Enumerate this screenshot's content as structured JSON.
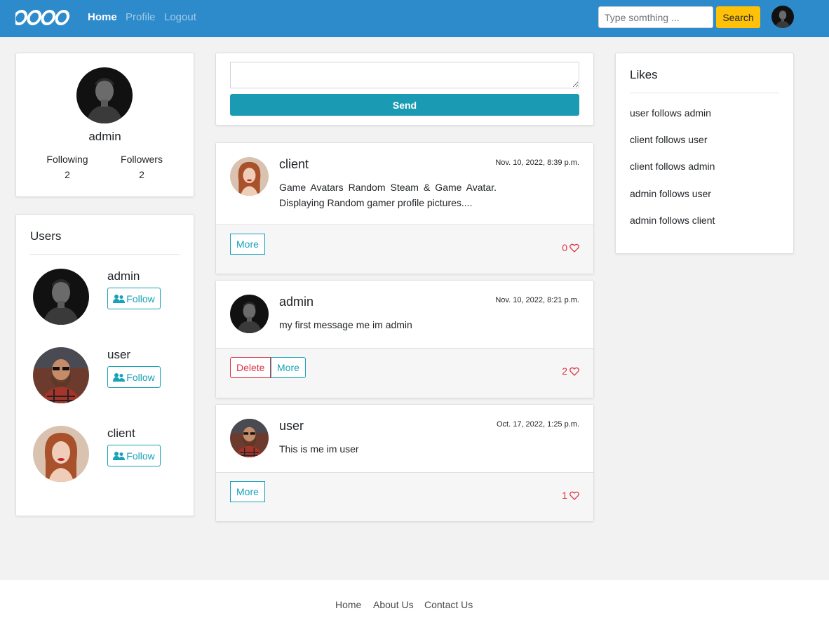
{
  "navbar": {
    "logo_icon": "oooo-logo-icon",
    "links": [
      "Home",
      "Profile",
      "Logout"
    ],
    "active_link": "Home",
    "search_placeholder": "Type somthing ...",
    "search_button": "Search",
    "brand_color": "#2d8acb",
    "search_button_color": "#ffc107"
  },
  "profile": {
    "name": "admin",
    "following_label": "Following",
    "following_count": "2",
    "followers_label": "Followers",
    "followers_count": "2"
  },
  "users": {
    "title": "Users",
    "items": [
      {
        "name": "admin",
        "button": "Follow",
        "icon": "user-friends-icon"
      },
      {
        "name": "user",
        "button": "Follow",
        "icon": "user-friends-icon"
      },
      {
        "name": "client",
        "button": "Follow",
        "icon": "user-friends-icon"
      }
    ]
  },
  "compose": {
    "send_label": "Send",
    "send_color": "#1b9bb3"
  },
  "posts": [
    {
      "author": "client",
      "time": "Nov. 10, 2022, 8:39 p.m.",
      "text": "Game Avatars Random Steam & Game Avatar. Displaying Random gamer profile pictures....",
      "more_label": "More",
      "delete_label": "",
      "likes": "0"
    },
    {
      "author": "admin",
      "time": "Nov. 10, 2022, 8:21 p.m.",
      "text": "my first message me im admin",
      "more_label": "More",
      "delete_label": "Delete",
      "likes": "2"
    },
    {
      "author": "user",
      "time": "Oct. 17, 2022, 1:25 p.m.",
      "text": "This is me im user",
      "more_label": "More",
      "delete_label": "",
      "likes": "1"
    }
  ],
  "likes": {
    "title": "Likes",
    "items": [
      "user follows admin",
      "client follows user",
      "client follows admin",
      "admin follows user",
      "admin follows client"
    ]
  },
  "footer": {
    "links": [
      "Home",
      "About Us",
      "Contact Us"
    ]
  }
}
